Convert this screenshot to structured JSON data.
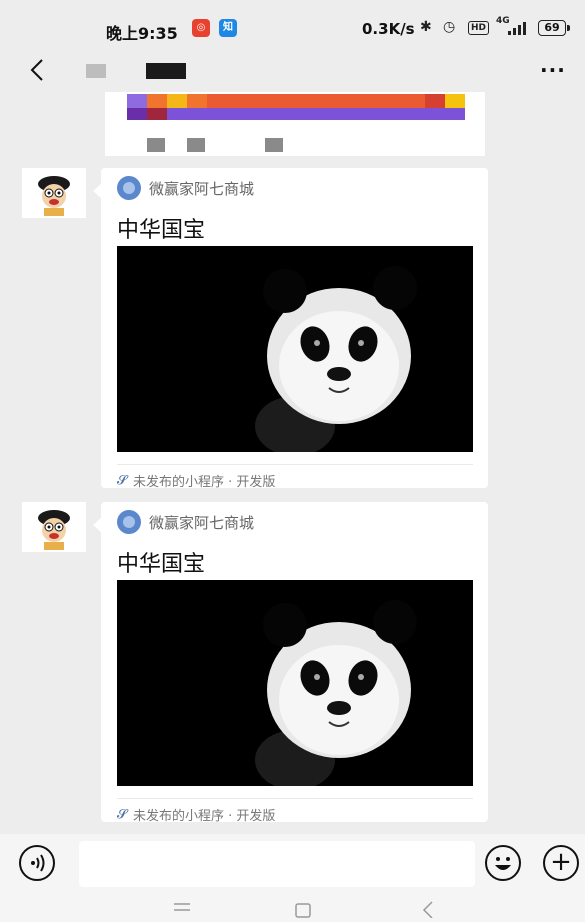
{
  "status_bar": {
    "time": "晚上9:35",
    "net_speed": "0.3K/s",
    "battery": "69",
    "signal": "4G",
    "hd_label": "HD"
  },
  "header": {
    "back_label": "<",
    "more_label": "···"
  },
  "messages": [
    {
      "app_name": "微赢家阿七商城",
      "title": "中华国宝",
      "footer": "未发布的小程序 · 开发版"
    },
    {
      "app_name": "微赢家阿七商城",
      "title": "中华国宝",
      "footer": "未发布的小程序 · 开发版"
    }
  ],
  "colors": {
    "background": "#ededed",
    "card": "#ffffff",
    "accent_link": "#4a6fa5"
  },
  "icons": {
    "status_badge_1": "weibo-red-icon",
    "status_badge_2": "zhihu-blue-icon",
    "bluetooth": "bluetooth-icon",
    "alarm": "alarm-icon",
    "voice": "voice-icon",
    "emoji": "emoji-icon",
    "plus": "plus-icon",
    "nav_menu": "nav-menu-icon",
    "nav_home": "nav-home-icon",
    "nav_back": "nav-back-icon"
  }
}
